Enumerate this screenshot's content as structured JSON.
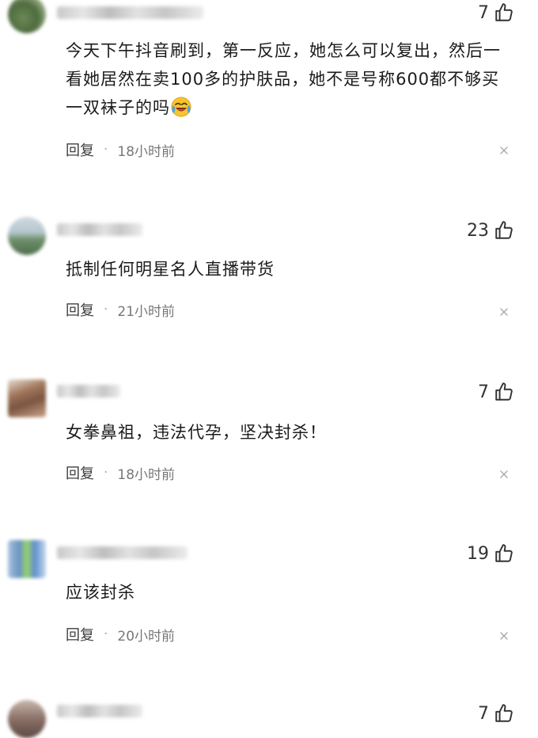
{
  "comments": [
    {
      "likes": "7",
      "text": "今天下午抖音刷到，第一反应，她怎么可以复出，然后一看她居然在卖100多的护肤品，她不是号称600都不够买一双袜子的吗",
      "emoji": "crying-laughing-emoji",
      "reply_label": "回复",
      "separator": "·",
      "time": "18小时前",
      "close_icon": "close-icon",
      "like_icon": "thumbs-up-icon"
    },
    {
      "likes": "23",
      "text": "抵制任何明星名人直播带货",
      "reply_label": "回复",
      "separator": "·",
      "time": "21小时前",
      "close_icon": "close-icon",
      "like_icon": "thumbs-up-icon"
    },
    {
      "likes": "7",
      "text": "女拳鼻祖，违法代孕，坚决封杀！",
      "reply_label": "回复",
      "separator": "·",
      "time": "18小时前",
      "close_icon": "close-icon",
      "like_icon": "thumbs-up-icon"
    },
    {
      "likes": "19",
      "text": "应该封杀",
      "reply_label": "回复",
      "separator": "·",
      "time": "20小时前",
      "close_icon": "close-icon",
      "like_icon": "thumbs-up-icon"
    },
    {
      "likes": "7",
      "like_icon": "thumbs-up-icon"
    }
  ]
}
